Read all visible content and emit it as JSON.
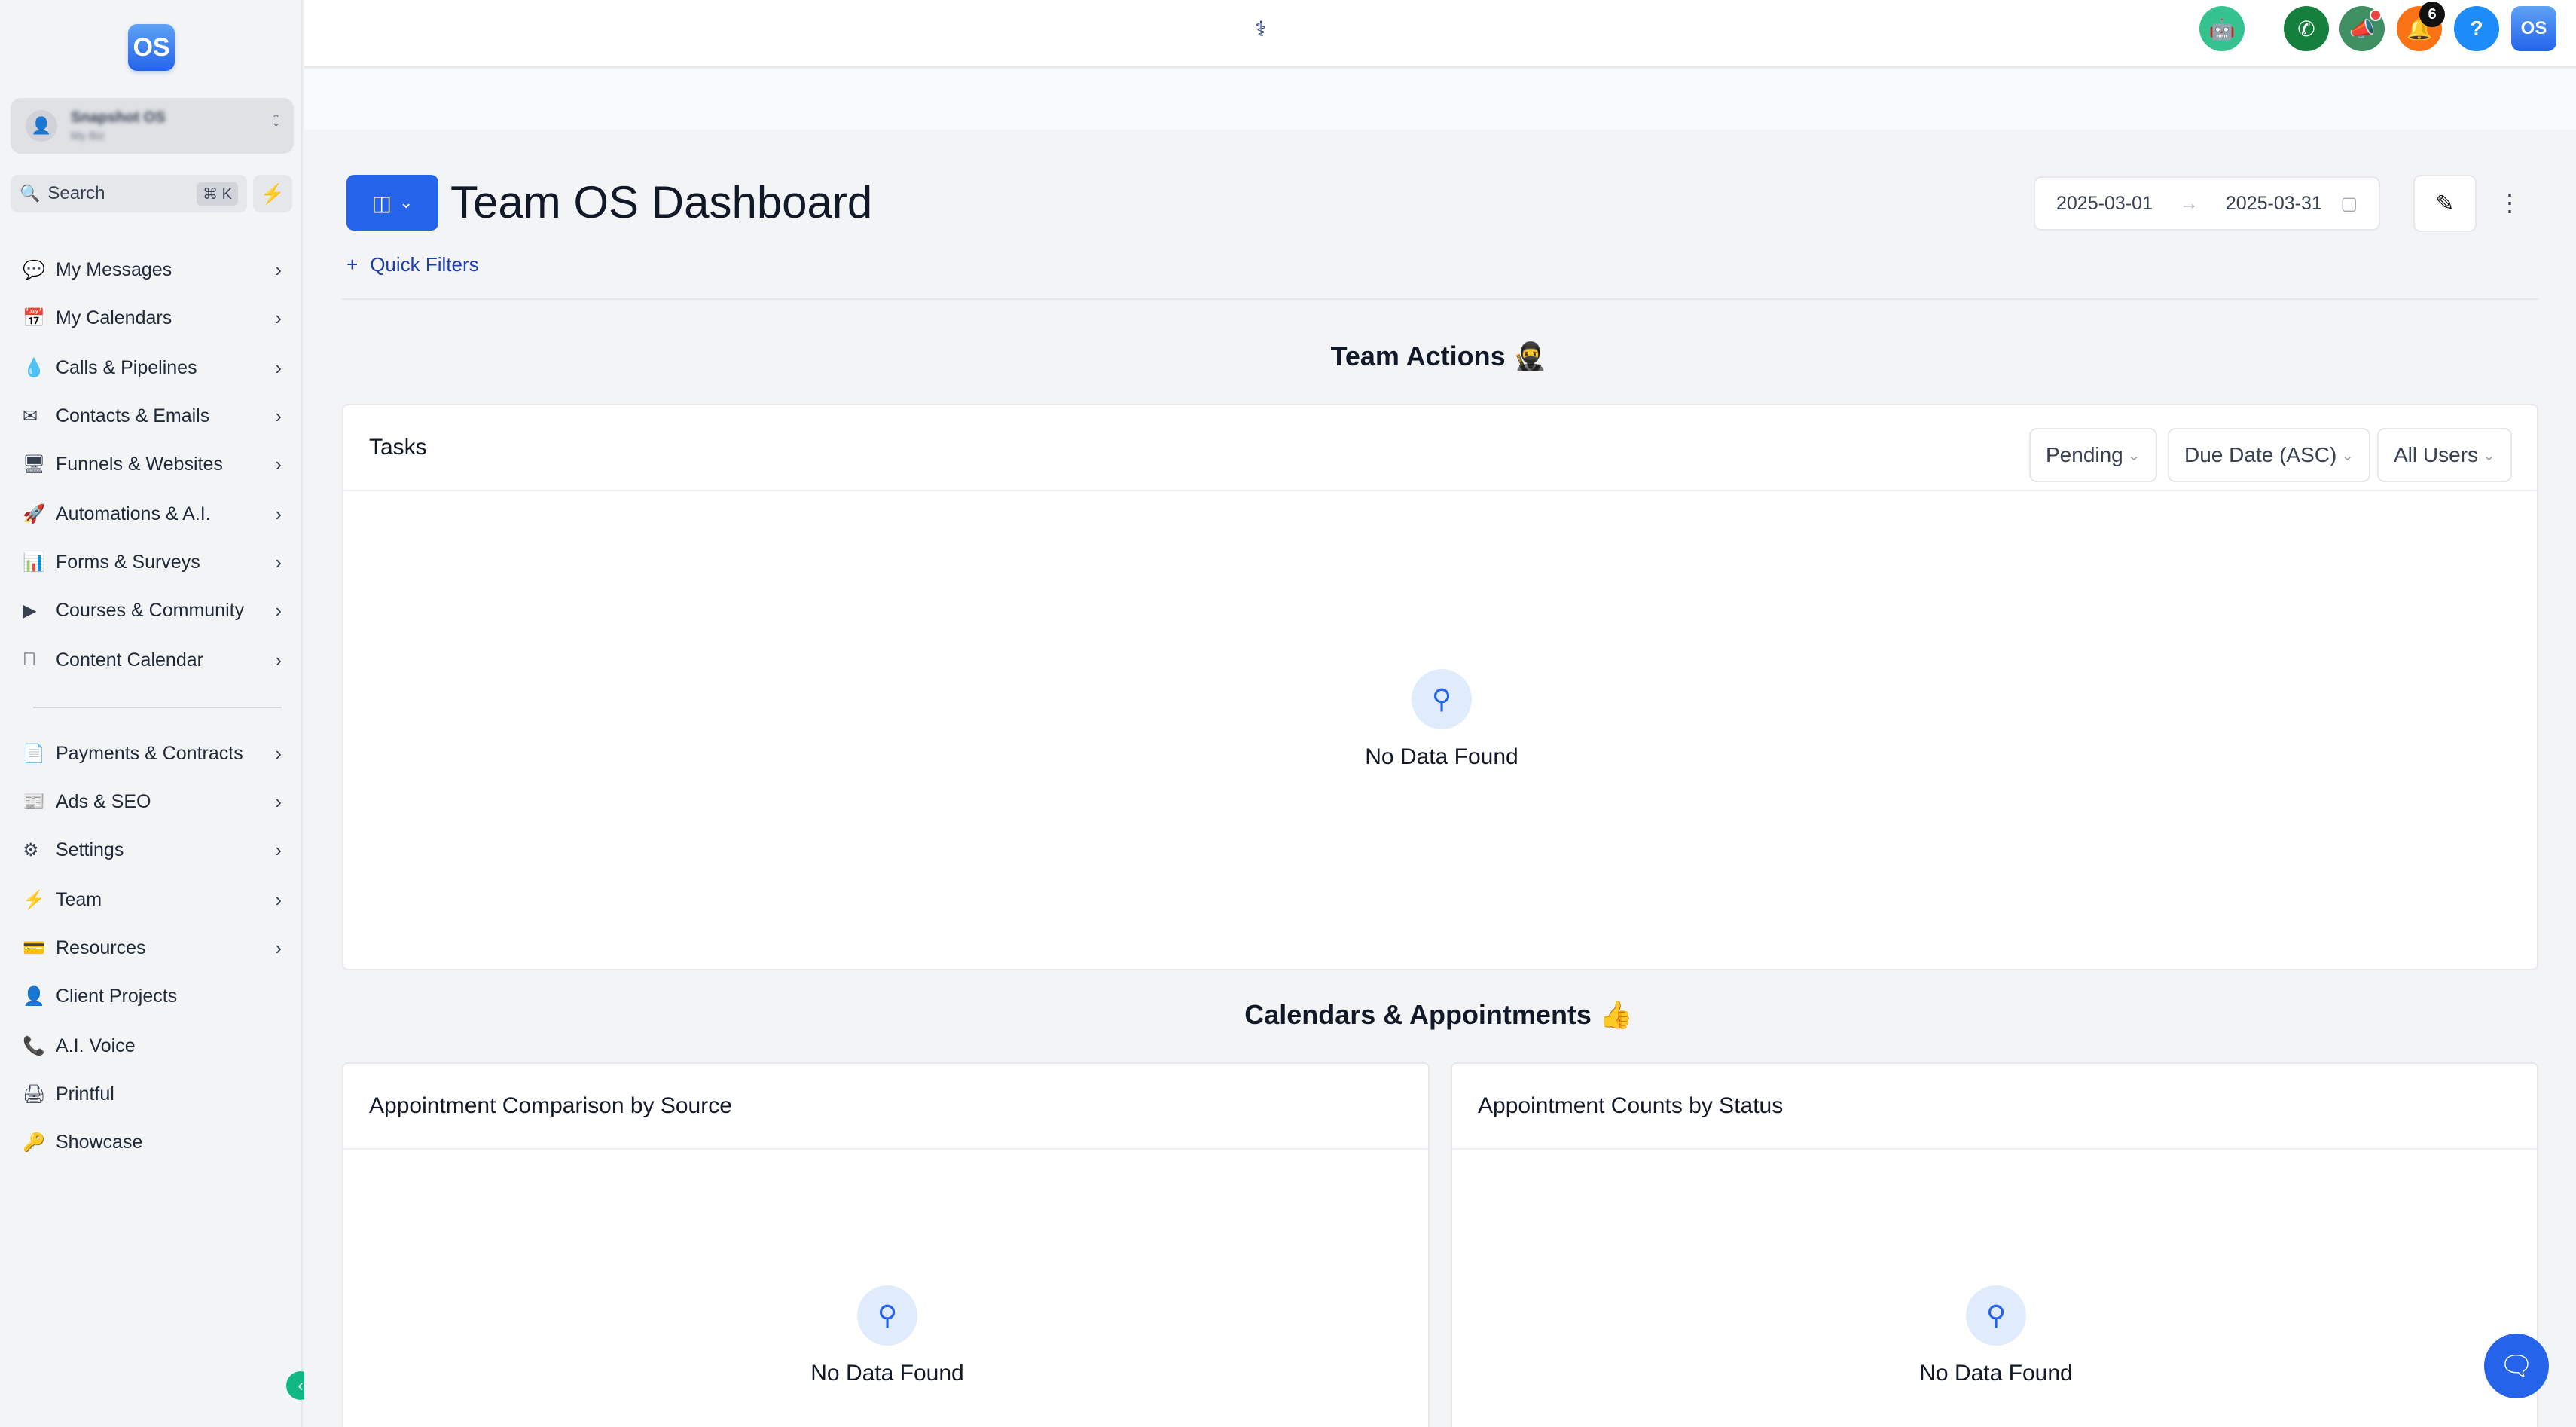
{
  "brand": {
    "logo_text": "OS"
  },
  "account": {
    "name": "Snapshot OS",
    "sub": "My Biz"
  },
  "search": {
    "label": "Search",
    "shortcut": "⌘ K"
  },
  "sidebar": {
    "items": [
      {
        "label": "My Messages",
        "icon": "messages-icon"
      },
      {
        "label": "My Calendars",
        "icon": "calendar-icon"
      },
      {
        "label": "Calls & Pipelines",
        "icon": "funnel-drop-icon"
      },
      {
        "label": "Contacts & Emails",
        "icon": "envelope-icon"
      },
      {
        "label": "Funnels & Websites",
        "icon": "monitor-icon"
      },
      {
        "label": "Automations & A.I.",
        "icon": "rocket-icon"
      },
      {
        "label": "Forms & Surveys",
        "icon": "chart-icon"
      },
      {
        "label": "Courses & Community",
        "icon": "video-icon"
      },
      {
        "label": "Content Calendar",
        "icon": "apple-icon"
      },
      {
        "label": "Payments & Contracts",
        "icon": "invoice-icon"
      },
      {
        "label": "Ads & SEO",
        "icon": "ad-icon"
      },
      {
        "label": "Settings",
        "icon": "gear-icon"
      },
      {
        "label": "Team",
        "icon": "bolt-icon"
      },
      {
        "label": "Resources",
        "icon": "card-icon"
      },
      {
        "label": "Client Projects",
        "icon": "user-icon"
      },
      {
        "label": "A.I. Voice",
        "icon": "phone-icon"
      },
      {
        "label": "Printful",
        "icon": "printer-icon"
      },
      {
        "label": "Showcase",
        "icon": "key-icon"
      }
    ]
  },
  "topbar": {
    "notification_count": "6",
    "help": "?",
    "avatar_text": "OS"
  },
  "dashboard": {
    "title": "Team OS Dashboard",
    "date_start": "2025-03-01",
    "date_end": "2025-03-31",
    "quick_filters": "Quick Filters"
  },
  "team_actions": {
    "title": "Team Actions 🥷",
    "card_title": "Tasks",
    "filters": [
      "Pending",
      "Due Date (ASC)",
      "All Users"
    ],
    "empty": "No Data Found"
  },
  "calendars": {
    "title": "Calendars & Appointments 👍",
    "cards": [
      {
        "title": "Appointment Comparison by Source",
        "empty": "No Data Found"
      },
      {
        "title": "Appointment Counts by Status",
        "empty": "No Data Found"
      }
    ]
  },
  "colors": {
    "accent": "#2563eb",
    "green": "#10b981",
    "orange": "#f97316"
  }
}
